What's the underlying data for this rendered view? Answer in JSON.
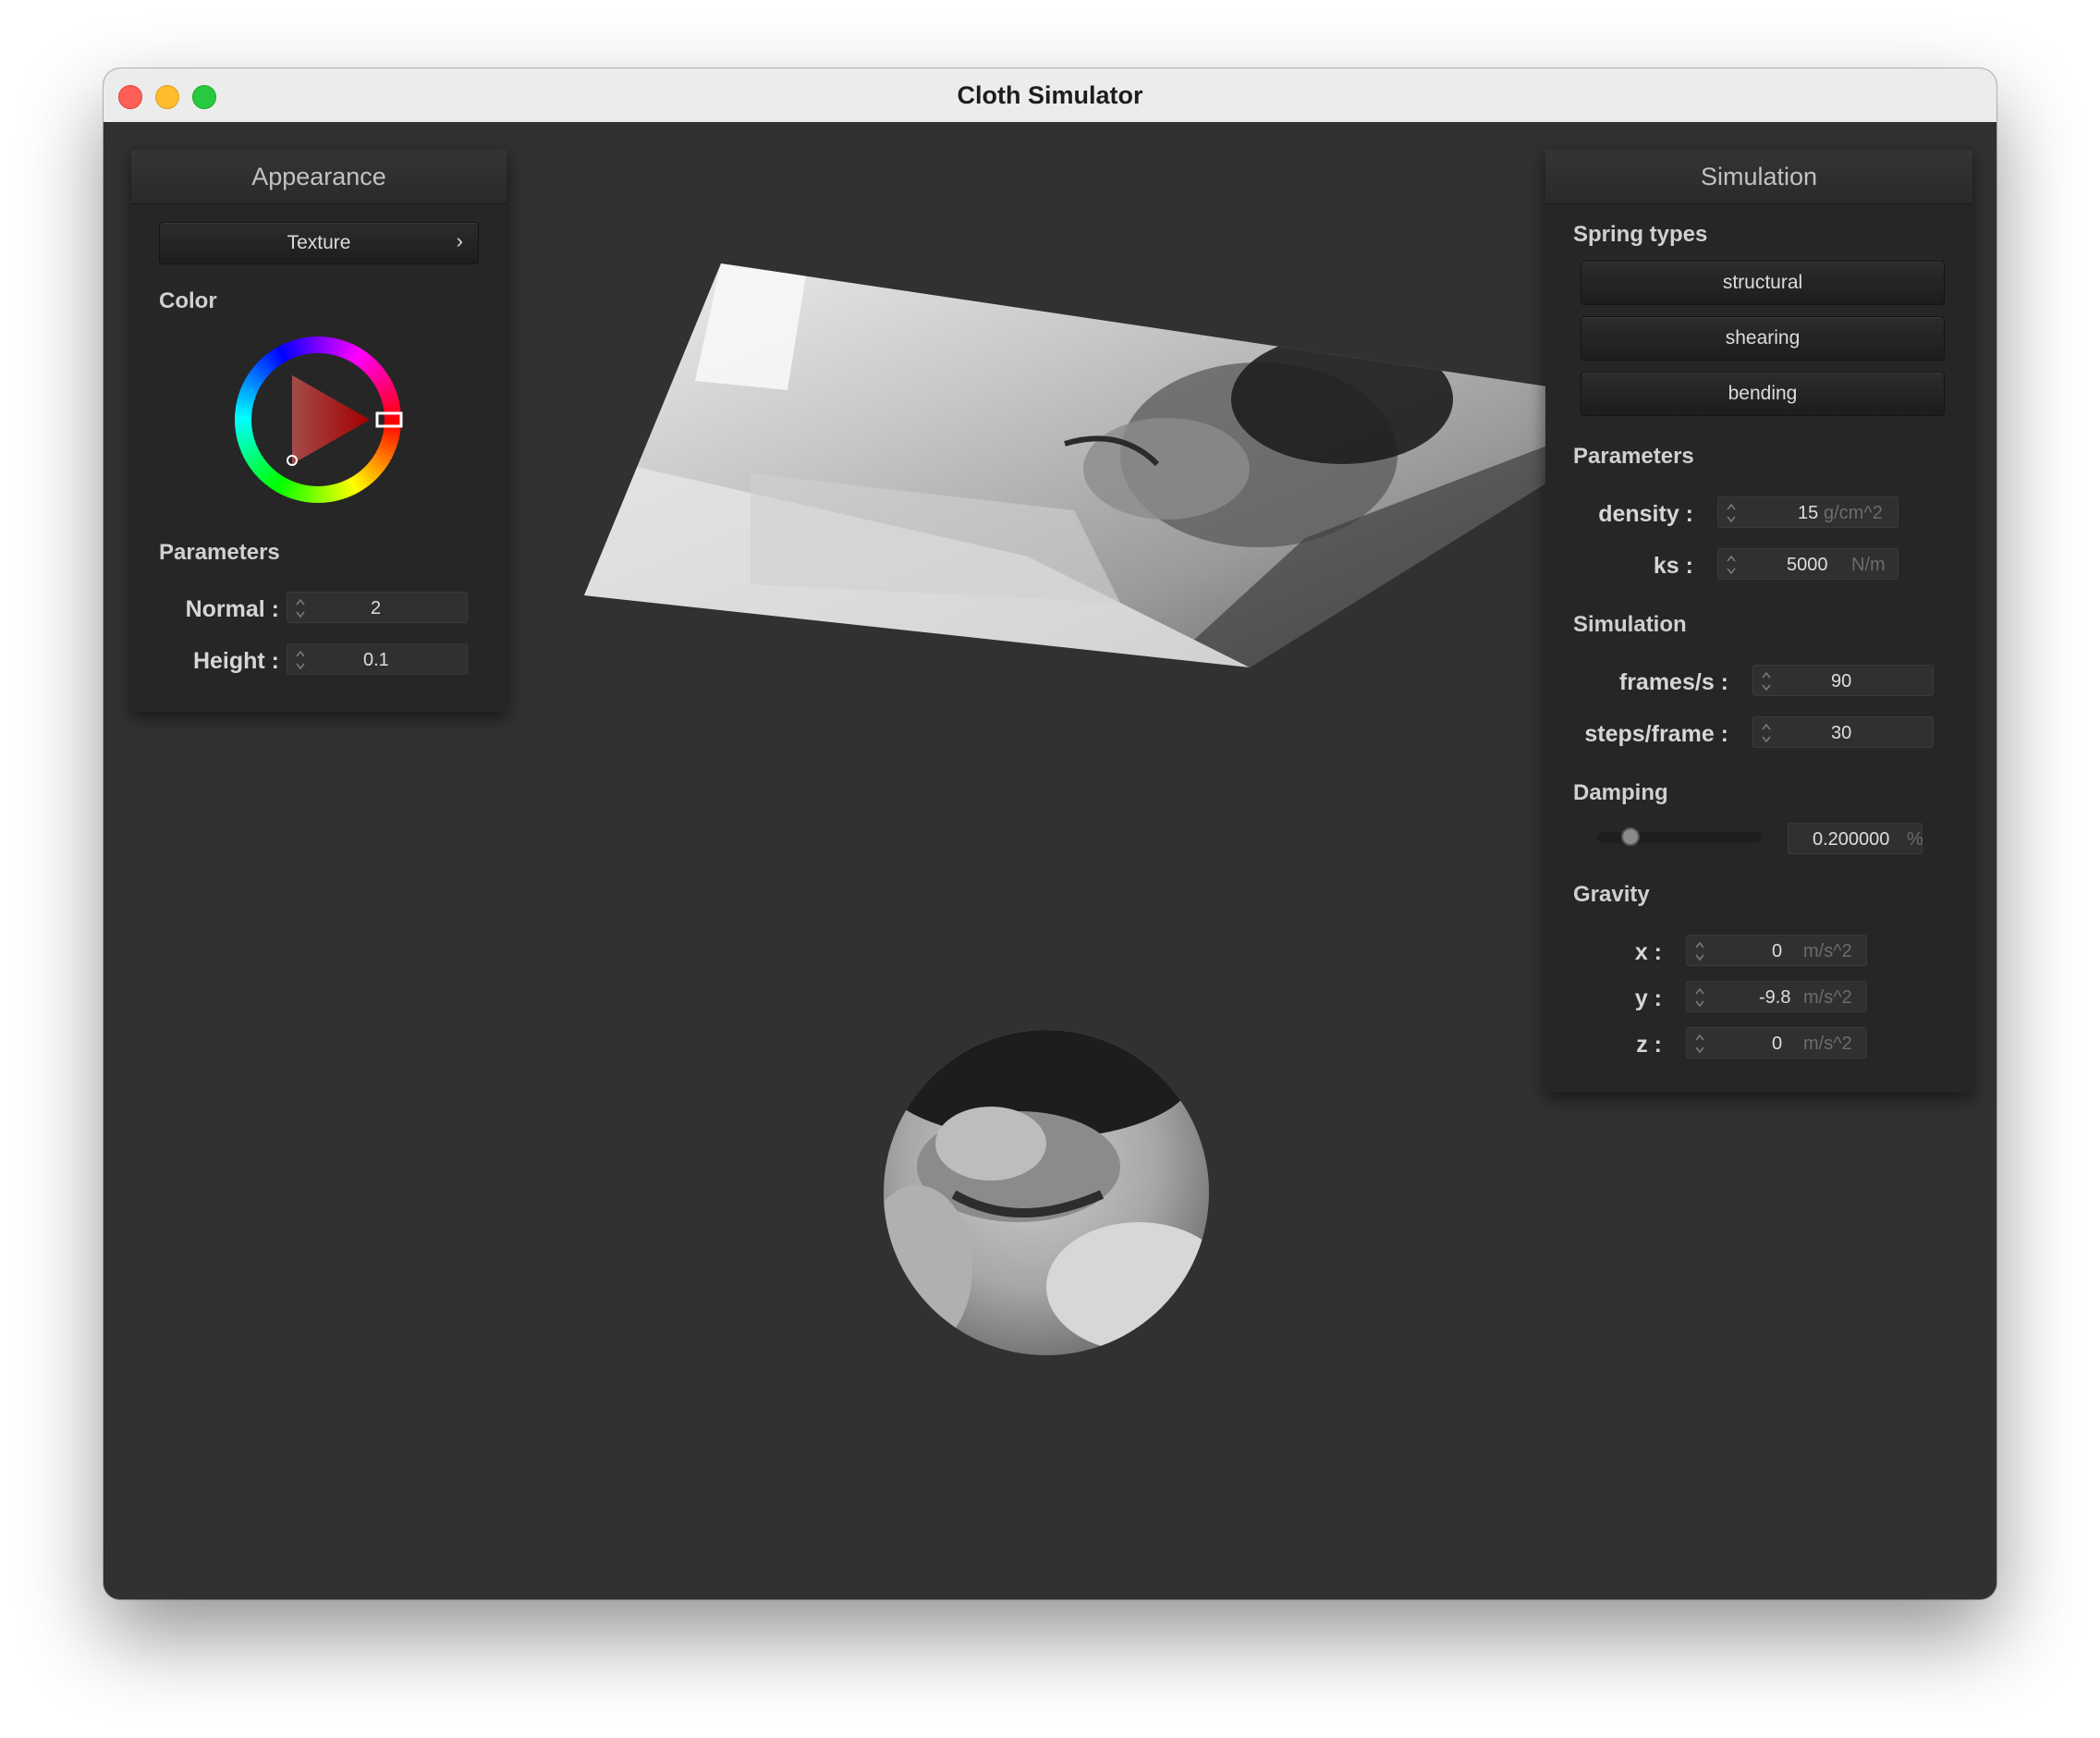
{
  "window": {
    "title": "Cloth Simulator"
  },
  "appearance": {
    "title": "Appearance",
    "texture_label": "Texture",
    "texture_chevron": "›",
    "color_label": "Color",
    "color_wheel": {
      "selected_hue_hex": "#ff0000"
    },
    "parameters_label": "Parameters",
    "normal_label": "Normal :",
    "normal_value": "2",
    "height_label": "Height :",
    "height_value": "0.1"
  },
  "simulation_panel": {
    "title": "Simulation",
    "spring_types_label": "Spring types",
    "spring_types": [
      "structural",
      "shearing",
      "bending"
    ],
    "parameters_label": "Parameters",
    "density_label": "density :",
    "density_value": "15",
    "density_unit": "g/cm^2",
    "ks_label": "ks :",
    "ks_value": "5000",
    "ks_unit": "N/m",
    "simulation_label": "Simulation",
    "fps_label": "frames/s :",
    "fps_value": "90",
    "steps_label": "steps/frame :",
    "steps_value": "30",
    "damping_label": "Damping",
    "damping_value": "0.200000",
    "damping_unit": "%",
    "damping_slider_fraction": 0.2,
    "gravity_label": "Gravity",
    "gx_label": "x :",
    "gx_value": "0",
    "gy_label": "y :",
    "gy_value": "-9.8",
    "gz_label": "z :",
    "gz_value": "0",
    "gravity_unit": "m/s^2"
  },
  "scene": {
    "cloth": "grayscale-photo-textured-cloth",
    "sphere": "grayscale-photo-textured-sphere"
  }
}
